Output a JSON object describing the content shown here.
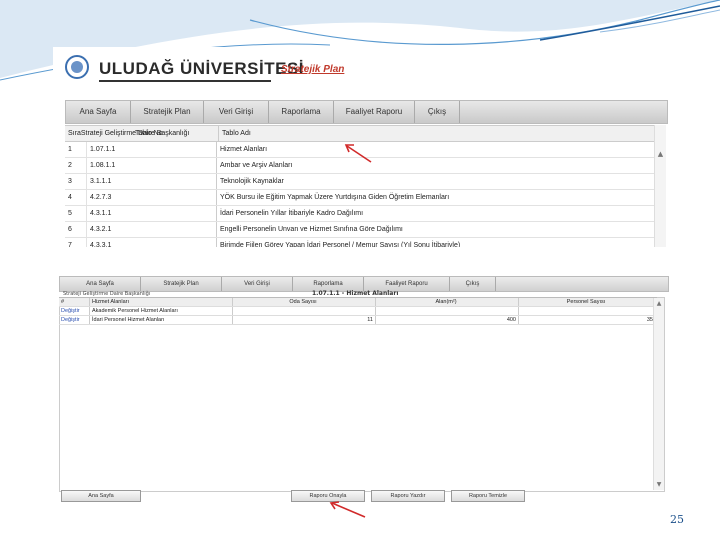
{
  "slide_number": "25",
  "top": {
    "university": "ULUDAĞ ÜNİVERSİTESİ",
    "product": "Stratejik Plan",
    "nav": [
      "Ana Sayfa",
      "Stratejik Plan",
      "Veri Girişi",
      "Raporlama",
      "Faaliyet Raporu",
      "Çıkış"
    ],
    "headers": {
      "sira": "Sıra",
      "strategy": "Strateji Geliştirme Daire Başkanlığı",
      "code": "Tablo No",
      "table": "Tablo Adı"
    },
    "rows": [
      {
        "sira": "1",
        "code": "1.07.1.1",
        "name": "Hizmet Alanları"
      },
      {
        "sira": "2",
        "code": "1.08.1.1",
        "name": "Ambar ve Arşiv Alanları"
      },
      {
        "sira": "3",
        "code": "3.1.1.1",
        "name": "Teknolojik Kaynaklar"
      },
      {
        "sira": "4",
        "code": "4.2.7.3",
        "name": "YÖK Bursu ile Eğitim Yapmak Üzere Yurtdışına Giden Öğretim Elemanları"
      },
      {
        "sira": "5",
        "code": "4.3.1.1",
        "name": "İdari Personelin Yıllar İtibariyle Kadro Dağılımı"
      },
      {
        "sira": "6",
        "code": "4.3.2.1",
        "name": "Engelli Personelin Unvan ve Hizmet Sınıfına Göre Dağılımı"
      },
      {
        "sira": "7",
        "code": "4.3.3.1",
        "name": "Birimde Fiilen Görev Yapan İdari Personel / Memur Sayısı (Yıl Sonu İtibariyle)"
      }
    ]
  },
  "bottom": {
    "nav": [
      "Ana Sayfa",
      "Stratejik Plan",
      "Veri Girişi",
      "Raporlama",
      "Faaliyet Raporu",
      "Çıkış"
    ],
    "context": "Strateji Geliştirme Daire Başkanlığı",
    "caption": "1.07.1.1 - Hizmet Alanları",
    "headers": [
      "#",
      "Hizmet Alanları",
      "Oda Sayısı",
      "Alan(m²)",
      "Personel Sayısı"
    ],
    "rows": [
      {
        "action": "Değiştir",
        "name": "Akademik Personel Hizmet Alanları",
        "rooms": "",
        "area": "",
        "staff": ""
      },
      {
        "action": "Değiştir",
        "name": "İdari Personel Hizmet Alanları",
        "rooms": "11",
        "area": "400",
        "staff": "35"
      }
    ],
    "buttons": {
      "back": "Ana Sayfa",
      "save": "Raporu Onayla",
      "print": "Raporu Yazdır",
      "clear": "Raporu Temizle"
    }
  }
}
